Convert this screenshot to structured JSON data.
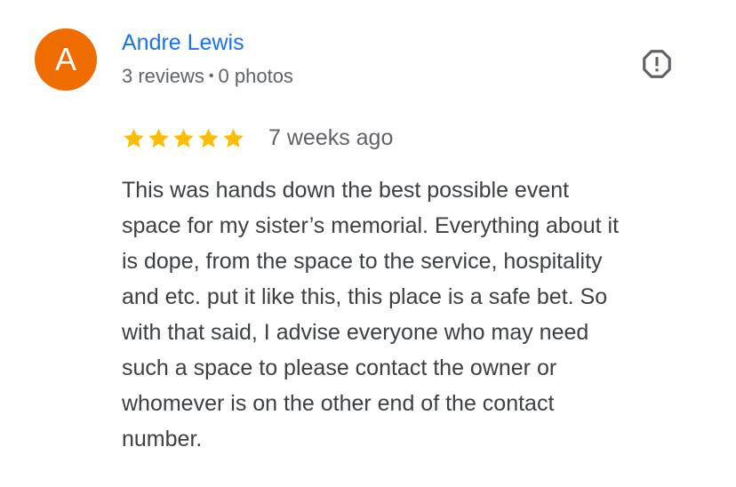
{
  "author": {
    "initial": "A",
    "name": "Andre Lewis",
    "reviews": "3 reviews",
    "separator": "•",
    "photos": "0 photos"
  },
  "colors": {
    "avatar_bg": "#ef6c00",
    "name": "#1a73e8",
    "star": "#fbbc04",
    "muted": "#5f6368",
    "body_text": "#3c4043"
  },
  "report_icon": "report-octagon-icon",
  "review": {
    "rating": 5,
    "max_rating": 5,
    "date": "7 weeks ago",
    "text": "This was hands down the best possible event\nspace for my sister’s memorial. Everything about it\nis dope, from the space to the service, hospitality\nand etc. put it like this, this place is a safe bet. So\nwith that said, I advise everyone who may need\nsuch a space to please contact the owner or\nwhomever is on the other end of the contact\nnumber."
  }
}
